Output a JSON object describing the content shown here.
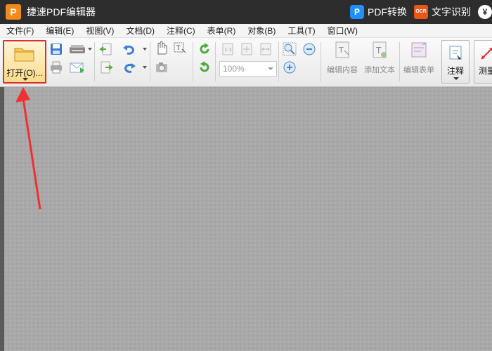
{
  "titlebar": {
    "logo_letter": "P",
    "title": "捷速PDF编辑器",
    "pdf_convert": "PDF转换",
    "ocr_badge": "OCR",
    "ocr_label": "文字识别",
    "yen_symbol": "¥"
  },
  "menu": [
    "文件(F)",
    "编辑(E)",
    "视图(V)",
    "文档(D)",
    "注释(C)",
    "表单(R)",
    "对象(B)",
    "工具(T)",
    "窗口(W)"
  ],
  "toolbar": {
    "open_label": "打开(O)...",
    "zoom_value": "100%",
    "edit_content": "编辑内容",
    "add_text": "添加文本",
    "edit_form": "编辑表单",
    "annotate": "注释",
    "measure": "测量"
  },
  "colors": {
    "accent_orange": "#f28a1c",
    "highlight_red": "#e02d2d",
    "titlebar": "#2d2d2d",
    "workspace": "#a9a9a9"
  }
}
